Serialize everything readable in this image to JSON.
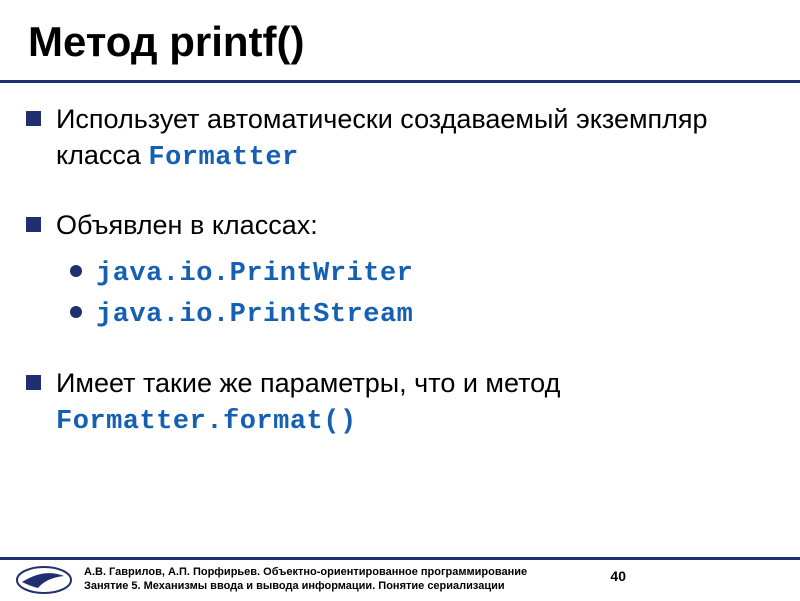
{
  "title": "Метод printf()",
  "bullets": {
    "b1_pre": "Использует автоматически создаваемый экземпляр класса ",
    "b1_code": "Formatter",
    "b2": "Объявлен в классах:",
    "b2_sub1": "java.io.PrintWriter",
    "b2_sub2": "java.io.PrintStream",
    "b3_pre": "Имеет такие же параметры, что и метод ",
    "b3_code": "Formatter.format()"
  },
  "footer": {
    "line1": "А.В. Гаврилов, А.П. Порфирьев. Объектно-ориентированное программирование",
    "line2": "Занятие 5. Механизмы ввода и вывода информации. Понятие сериализации"
  },
  "page_number": "40"
}
